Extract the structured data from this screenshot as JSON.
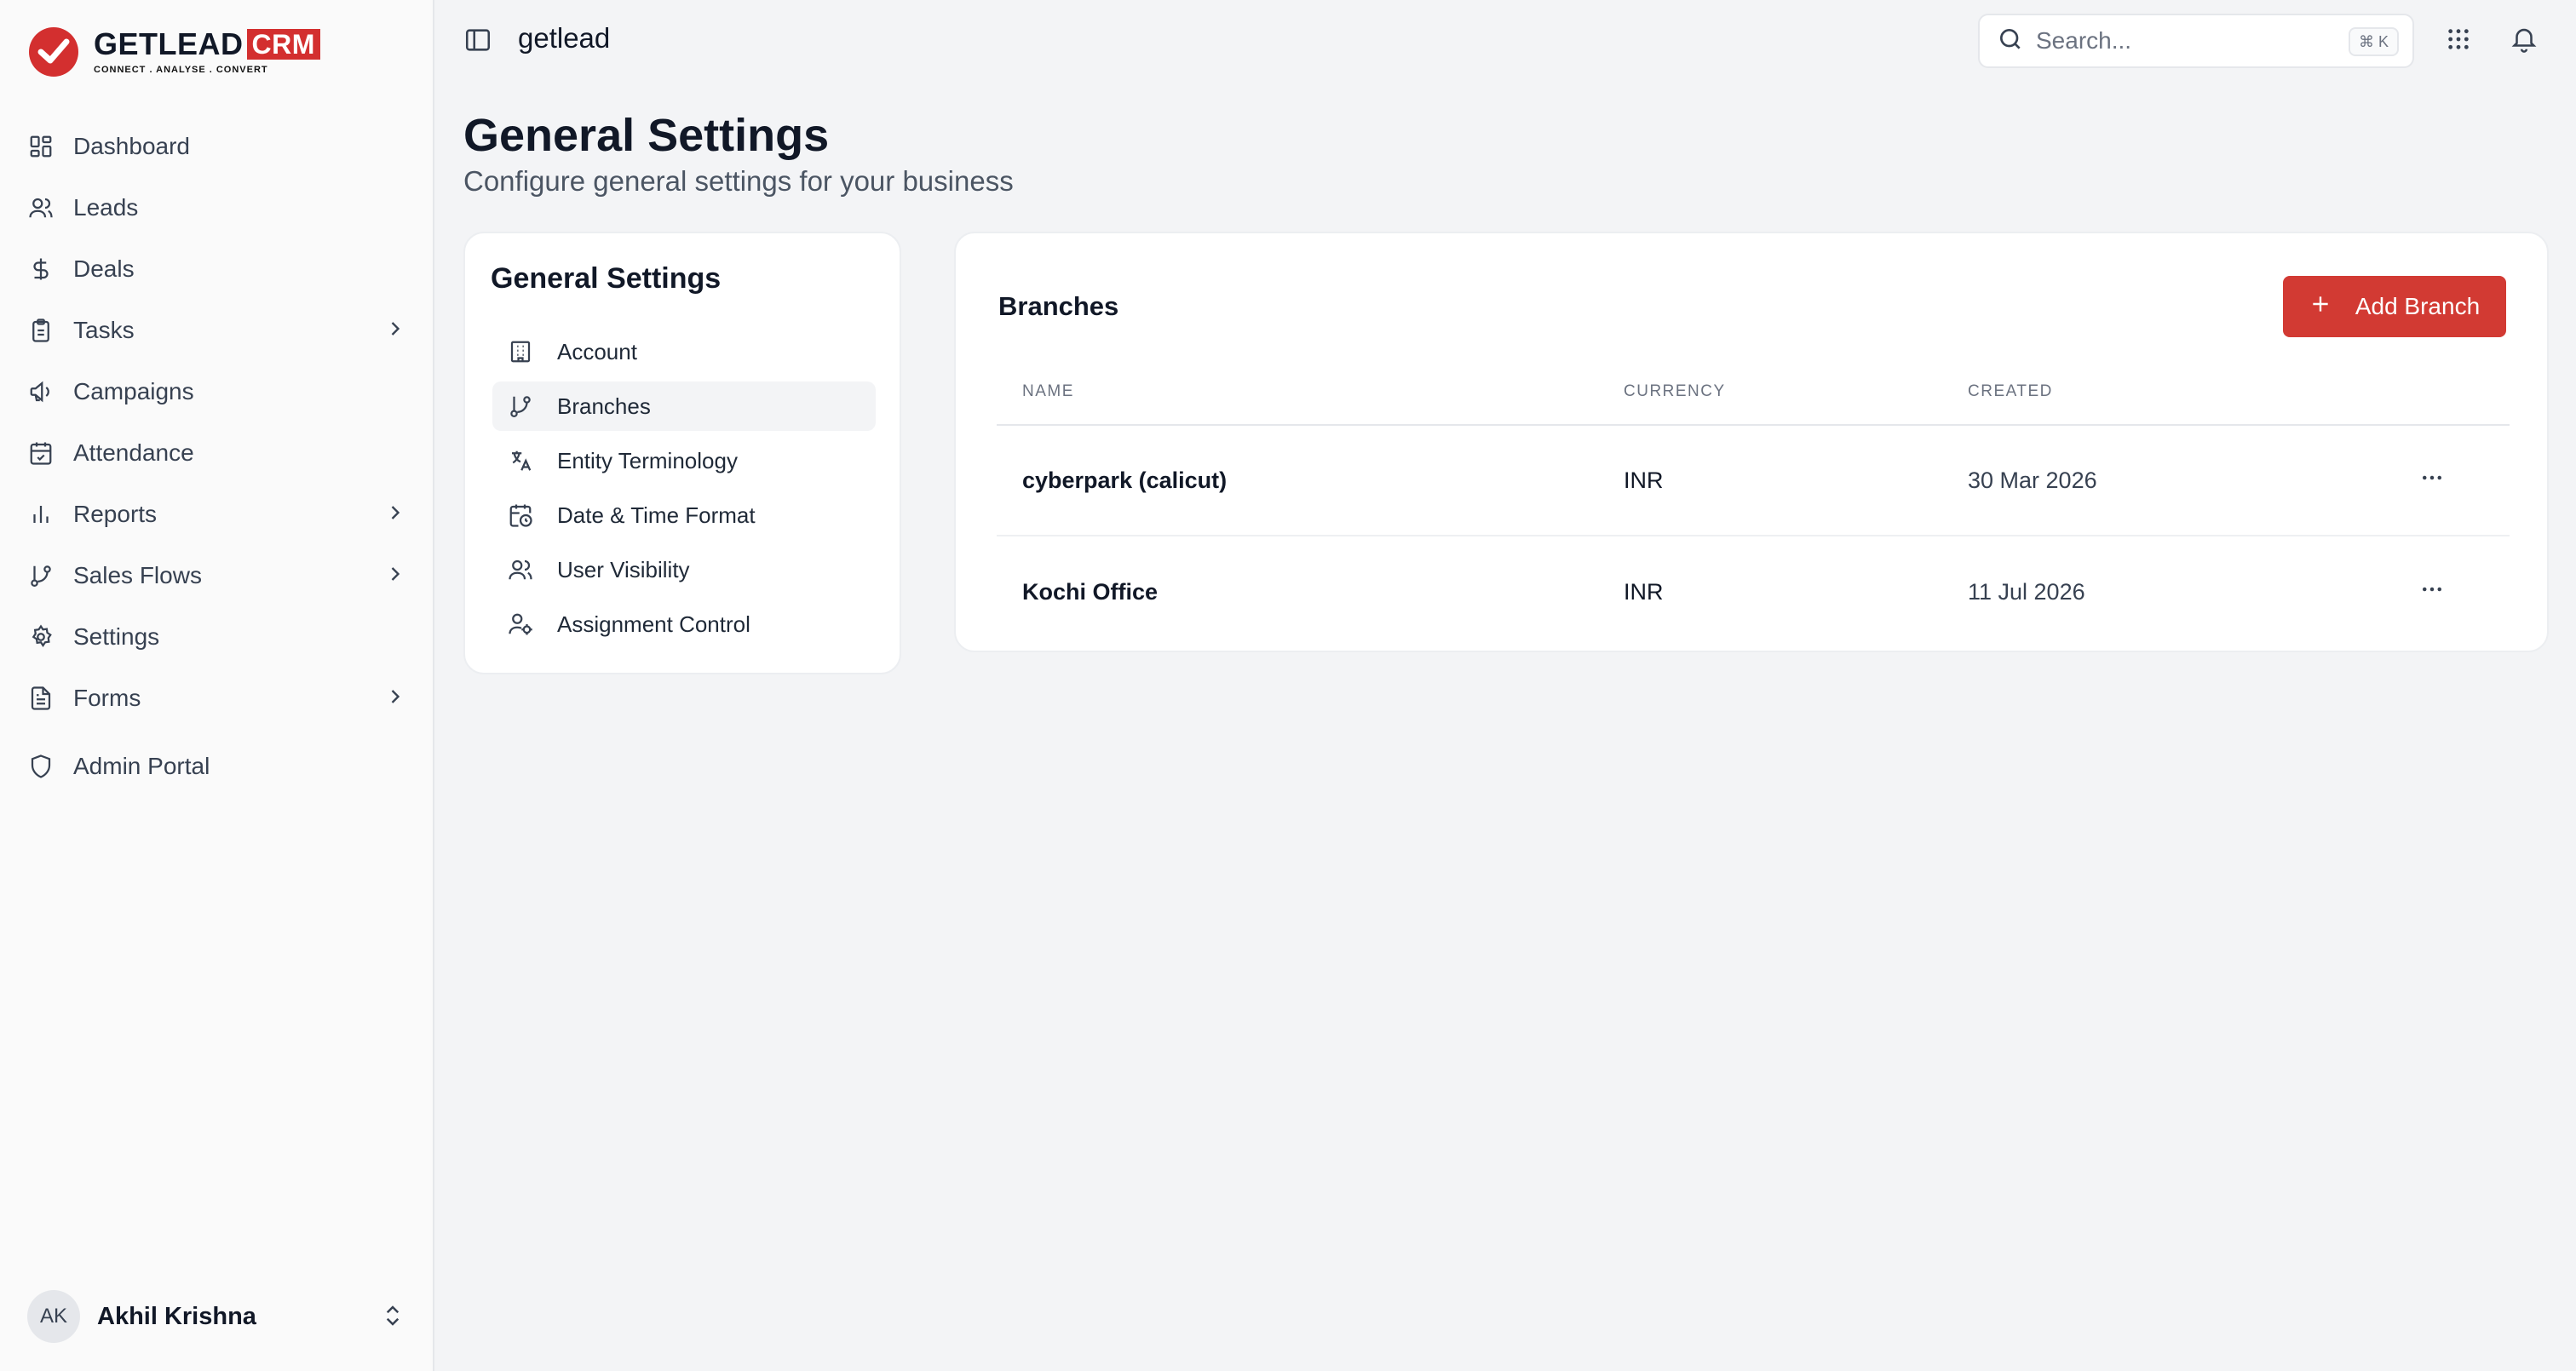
{
  "brand": {
    "name": "GETLEAD",
    "badge": "CRM",
    "tagline": "CONNECT  .  ANALYSE  .  CONVERT",
    "accent_color": "#d32f2f"
  },
  "sidebar": {
    "items": [
      {
        "label": "Dashboard",
        "icon": "dashboard-icon",
        "has_submenu": false
      },
      {
        "label": "Leads",
        "icon": "users-icon",
        "has_submenu": false
      },
      {
        "label": "Deals",
        "icon": "dollar-icon",
        "has_submenu": false
      },
      {
        "label": "Tasks",
        "icon": "clipboard-icon",
        "has_submenu": true
      },
      {
        "label": "Campaigns",
        "icon": "megaphone-icon",
        "has_submenu": false
      },
      {
        "label": "Attendance",
        "icon": "calendar-check-icon",
        "has_submenu": false
      },
      {
        "label": "Reports",
        "icon": "bar-chart-icon",
        "has_submenu": true
      },
      {
        "label": "Sales Flows",
        "icon": "git-branch-icon",
        "has_submenu": true
      },
      {
        "label": "Settings",
        "icon": "gear-icon",
        "has_submenu": false
      },
      {
        "label": "Forms",
        "icon": "file-text-icon",
        "has_submenu": true
      }
    ],
    "admin": {
      "label": "Admin Portal",
      "icon": "shield-icon"
    },
    "user": {
      "initials": "AK",
      "name": "Akhil Krishna"
    }
  },
  "header": {
    "workspace": "getlead",
    "search_placeholder": "Search...",
    "search_shortcut": "⌘ K"
  },
  "page": {
    "title": "General Settings",
    "subtitle": "Configure general settings for your business"
  },
  "settings_menu": {
    "title": "General Settings",
    "items": [
      {
        "label": "Account",
        "icon": "building-icon",
        "active": false
      },
      {
        "label": "Branches",
        "icon": "git-branch-icon",
        "active": true
      },
      {
        "label": "Entity Terminology",
        "icon": "translate-icon",
        "active": false
      },
      {
        "label": "Date & Time Format",
        "icon": "calendar-clock-icon",
        "active": false
      },
      {
        "label": "User Visibility",
        "icon": "users-icon",
        "active": false
      },
      {
        "label": "Assignment Control",
        "icon": "user-cog-icon",
        "active": false
      }
    ]
  },
  "branches": {
    "title": "Branches",
    "add_label": "Add Branch",
    "columns": [
      "NAME",
      "CURRENCY",
      "CREATED"
    ],
    "rows": [
      {
        "name": "cyberpark (calicut)",
        "currency": "INR",
        "created": "30 Mar 2026"
      },
      {
        "name": "Kochi Office",
        "currency": "INR",
        "created": "11 Jul 2026"
      }
    ]
  }
}
